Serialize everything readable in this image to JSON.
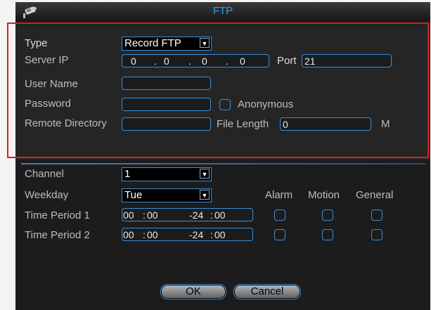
{
  "window": {
    "title": "FTP"
  },
  "ftp": {
    "type_label": "Type",
    "type_value": "Record FTP",
    "server_ip_label": "Server IP",
    "server_ip": [
      "0",
      "0",
      "0",
      "0"
    ],
    "ip_dot": ".",
    "port_label": "Port",
    "port_value": "21",
    "user_name_label": "User Name",
    "user_name_value": "",
    "password_label": "Password",
    "password_value": "",
    "anonymous_label": "Anonymous",
    "anonymous_checked": false,
    "remote_directory_label": "Remote Directory",
    "remote_directory_value": "",
    "file_length_label": "File Length",
    "file_length_value": "0",
    "file_length_unit": "M"
  },
  "schedule": {
    "channel_label": "Channel",
    "channel_value": "1",
    "weekday_label": "Weekday",
    "weekday_value": "Tue",
    "columns": [
      "Alarm",
      "Motion",
      "General"
    ],
    "periods": [
      {
        "label": "Time Period 1",
        "start_h": "00",
        "start_m": "00",
        "dash_end_h": "-24",
        "end_m": "00",
        "alarm": false,
        "motion": false,
        "general": false
      },
      {
        "label": "Time Period 2",
        "start_h": "00",
        "start_m": "00",
        "dash_end_h": "-24",
        "end_m": "00",
        "alarm": false,
        "motion": false,
        "general": false
      }
    ],
    "time_sep": ":"
  },
  "buttons": {
    "ok": "OK",
    "cancel": "Cancel"
  },
  "colors": {
    "title": "#29a3f5",
    "field_border": "#3a8fd8",
    "highlight_box": "#d62020",
    "background": "#1c1c1c"
  },
  "icons": {
    "logo": "camera-logo-icon",
    "dropdown": "chevron-down-icon"
  }
}
